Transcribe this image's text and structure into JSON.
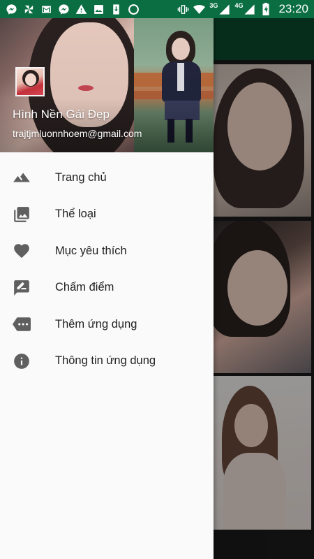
{
  "status_bar": {
    "icons": [
      "messenger-icon",
      "pinwheel-icon",
      "gmail-icon",
      "messenger-icon",
      "warning-icon",
      "image-icon",
      "download-icon",
      "circle-icon"
    ],
    "right_icons": [
      "vibrate-icon",
      "wifi-icon",
      "signal-3g-icon",
      "signal-4g-icon",
      "battery-charging-icon"
    ],
    "network_1": "3G",
    "network_2": "4G",
    "time": "23:20"
  },
  "drawer": {
    "header": {
      "title": "Hình Nền Gái Đẹp",
      "email": "trajtjmluonnhoem@gmail.com"
    },
    "items": [
      {
        "label": "Trang chủ",
        "icon": "mountains-icon"
      },
      {
        "label": "Thể loại",
        "icon": "photo-library-icon"
      },
      {
        "label": "Mục yêu thích",
        "icon": "heart-icon"
      },
      {
        "label": "Chấm điểm",
        "icon": "rate-review-icon"
      },
      {
        "label": "Thêm ứng dụng",
        "icon": "more-label-icon"
      },
      {
        "label": "Thông tin ứng dụng",
        "icon": "info-icon"
      }
    ]
  },
  "colors": {
    "status_bar": "#0b6e43",
    "toolbar": "#0a4a2c",
    "icon_grey": "#5f5f5f"
  }
}
